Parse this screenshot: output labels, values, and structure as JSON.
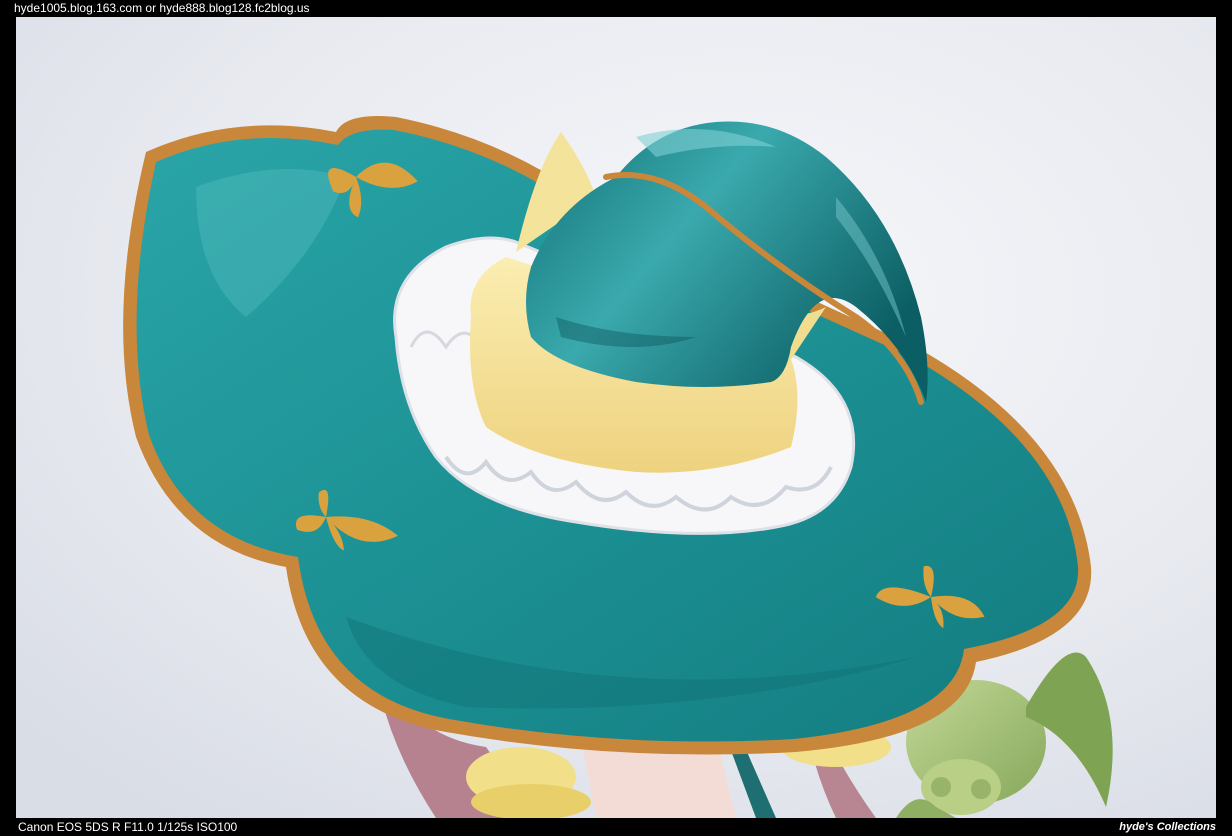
{
  "header": {
    "blog_urls": "hyde1005.blog.163.com or hyde888.blog128.fc2blog.us"
  },
  "photo": {
    "subject_icon": "witch-hat-figure-photo"
  },
  "footer": {
    "exif": "Canon EOS 5DS R F11.0 1/125s ISO100",
    "credit": "hyde's Collections"
  },
  "colors": {
    "frame": "#000000",
    "background": "#eef0f4",
    "hat_teal": "#1f8f93",
    "gold_trim": "#c8873a",
    "ribbon_yellow": "#f5e39a",
    "ruffle_white": "#f7f7f9",
    "creature_green": "#a9c27a"
  }
}
